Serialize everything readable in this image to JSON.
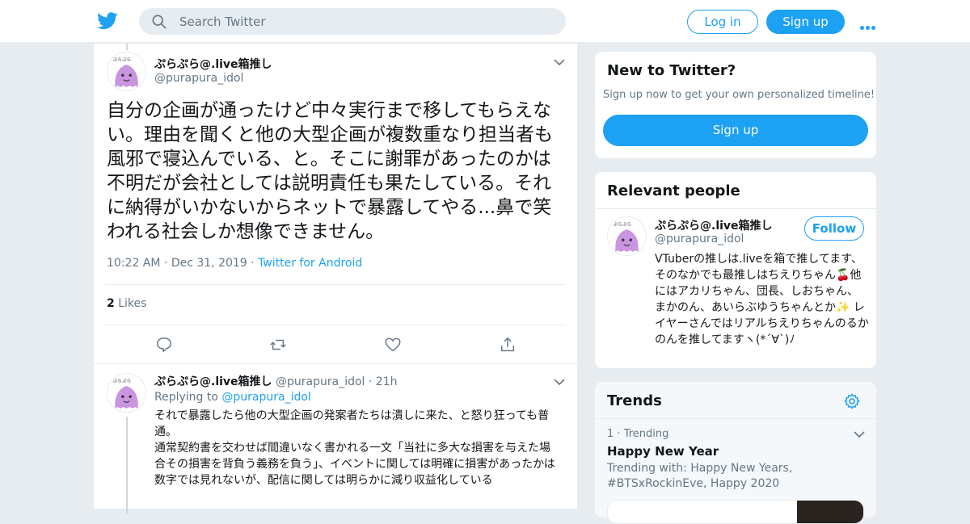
{
  "header": {
    "search_placeholder": "Search Twitter",
    "login_label": "Log in",
    "signup_label": "Sign up"
  },
  "tweet": {
    "display_name": "ぷらぷら@.live箱推し",
    "handle": "@purapura_idol",
    "text": "自分の企画が通ったけど中々実行まで移してもらえない。理由を聞くと他の大型企画が複数重なり担当者も風邪で寝込んでいる、と。そこに謝罪があったのかは不明だが会社としては説明責任も果たしている。それに納得がいかないからネットで暴露してやる...鼻で笑われる社会しか想像できません。",
    "time": "10:22 AM",
    "date": "Dec 31, 2019",
    "source": "Twitter for Android",
    "likes_count": "2",
    "likes_label": "Likes"
  },
  "reply": {
    "display_name": "ぷらぷら@.live箱推し",
    "handle": "@purapura_idol",
    "age": "21h",
    "replying_prefix": "Replying to",
    "replying_to": "@purapura_idol",
    "text_1": "それで暴露したら他の大型企画の発案者たちは潰しに来た、と怒り狂っても普通。",
    "text_2": "通常契約書を交わせば間違いなく書かれる一文「当社に多大な損害を与えた場合その損害を背負う義務を負う」、イベントに関しては明確に損害があったかは数字では見れないが、配信に関しては明らかに減り収益化している"
  },
  "new_to_twitter": {
    "title": "New to Twitter?",
    "subtitle": "Sign up now to get your own personalized timeline!",
    "button": "Sign up"
  },
  "relevant": {
    "title": "Relevant people",
    "display_name": "ぷらぷら@.live箱推し",
    "handle": "@purapura_idol",
    "follow_label": "Follow",
    "bio": "VTuberの推しは.liveを箱で推してます、そのなかでも最推しはちえりちゃん🍒他にはアカリちゃん、団長、しおちゃん、まかのん、あいらぶゆうちゃんとか✨ レイヤーさんではリアルちえりちゃんのるかのんを推してますヽ(*´∀`)ﾉ"
  },
  "trends": {
    "title": "Trends",
    "item_rank": "1",
    "item_label": "Trending",
    "item_name": "Happy New Year",
    "item_with": "Trending with: Happy New Years, #BTSxRockinEve, Happy 2020"
  },
  "colors": {
    "brand": "#1da1f2",
    "text": "#14171a",
    "muted": "#657786",
    "border": "#e6ecf0"
  }
}
